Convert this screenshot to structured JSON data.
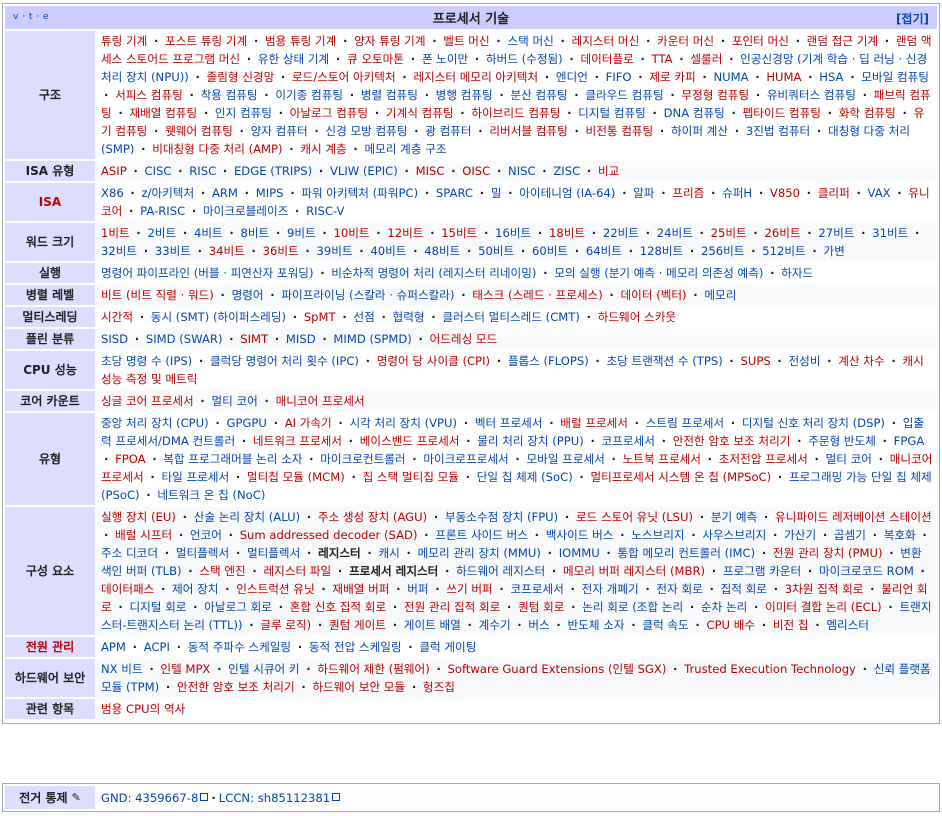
{
  "navbox": {
    "vte": [
      "v",
      "t",
      "e"
    ],
    "title": "프로세서 기술",
    "collapse_label": "[접기]"
  },
  "rows": [
    {
      "header": "구조",
      "header_red": false,
      "items": [
        [
          "튜링 기계",
          "new"
        ],
        [
          "포스트 튜링 기계",
          "new"
        ],
        [
          "범용 튜링 기계",
          "new"
        ],
        [
          "양자 튜링 기계",
          "new"
        ],
        [
          "벨트 머신",
          "new"
        ],
        [
          "스택 머신",
          "lnk"
        ],
        [
          "레지스터 머신",
          "new"
        ],
        [
          "카운터 머신",
          "new"
        ],
        [
          "포인터 머신",
          "new"
        ],
        [
          "랜덤 접근 기계",
          "new"
        ],
        [
          "랜덤 액세스 스토어드 프로그램 머신",
          "new"
        ],
        [
          "유한 상태 기계",
          "lnk"
        ],
        [
          "큐 오토마톤",
          "new"
        ],
        [
          "폰 노이만",
          "lnk"
        ],
        [
          "하버드 (수정됨)",
          "lnk"
        ],
        [
          "데이터플로",
          "new"
        ],
        [
          "TTA",
          "new"
        ],
        [
          "셀룰러",
          "new"
        ],
        [
          "인공신경망 (기계 학습 · 딥 러닝 · 신경 처리 장치 (NPU))",
          "lnk"
        ],
        [
          "졸림형 신경망",
          "new"
        ],
        [
          "로드/스토어 아키텍처",
          "new"
        ],
        [
          "레지스터 메모리 아키텍처",
          "new"
        ],
        [
          "엔디언",
          "lnk"
        ],
        [
          "FIFO",
          "lnk"
        ],
        [
          "제로 카피",
          "new"
        ],
        [
          "NUMA",
          "lnk"
        ],
        [
          "HUMA",
          "new"
        ],
        [
          "HSA",
          "lnk"
        ],
        [
          "모바일 컴퓨팅",
          "lnk"
        ],
        [
          "서피스 컴퓨팅",
          "new"
        ],
        [
          "착용 컴퓨팅",
          "lnk"
        ],
        [
          "이기종 컴퓨팅",
          "lnk"
        ],
        [
          "병렬 컴퓨팅",
          "lnk"
        ],
        [
          "병행 컴퓨팅",
          "lnk"
        ],
        [
          "분산 컴퓨팅",
          "lnk"
        ],
        [
          "클라우드 컴퓨팅",
          "lnk"
        ],
        [
          "무정형 컴퓨팅",
          "new"
        ],
        [
          "유비쿼터스 컴퓨팅",
          "lnk"
        ],
        [
          "패브릭 컴퓨팅",
          "new"
        ],
        [
          "재배열 컴퓨팅",
          "new"
        ],
        [
          "인지 컴퓨팅",
          "lnk"
        ],
        [
          "아날로그 컴퓨팅",
          "new"
        ],
        [
          "기계식 컴퓨팅",
          "new"
        ],
        [
          "하이브리드 컴퓨팅",
          "new"
        ],
        [
          "디지털 컴퓨팅",
          "lnk"
        ],
        [
          "DNA 컴퓨팅",
          "lnk"
        ],
        [
          "펩타이드 컴퓨팅",
          "new"
        ],
        [
          "화학 컴퓨팅",
          "new"
        ],
        [
          "유기 컴퓨팅",
          "new"
        ],
        [
          "웻웨어 컴퓨팅",
          "new"
        ],
        [
          "양자 컴퓨터",
          "lnk"
        ],
        [
          "신경 모방 컴퓨팅",
          "lnk"
        ],
        [
          "광 컴퓨터",
          "lnk"
        ],
        [
          "리버서블 컴퓨팅",
          "new"
        ],
        [
          "비전통 컴퓨팅",
          "new"
        ],
        [
          "하이퍼 계산",
          "lnk"
        ],
        [
          "3진법 컴퓨터",
          "lnk"
        ],
        [
          "대칭형 다중 처리 (SMP)",
          "lnk"
        ],
        [
          "비대칭형 다중 처리 (AMP)",
          "new"
        ],
        [
          "캐시 계층",
          "new"
        ],
        [
          "메모리 계층 구조",
          "lnk"
        ]
      ]
    },
    {
      "header": "ISA 유형",
      "header_red": false,
      "items": [
        [
          "ASIP",
          "new"
        ],
        [
          "CISC",
          "lnk"
        ],
        [
          "RISC",
          "lnk"
        ],
        [
          "EDGE (TRIPS)",
          "lnk"
        ],
        [
          "VLIW (EPIC)",
          "lnk"
        ],
        [
          "MISC",
          "new"
        ],
        [
          "OISC",
          "new"
        ],
        [
          "NISC",
          "lnk"
        ],
        [
          "ZISC",
          "lnk"
        ],
        [
          "비교",
          "new"
        ]
      ]
    },
    {
      "header": "ISA",
      "header_red": true,
      "items": [
        [
          "X86",
          "lnk"
        ],
        [
          "z/아키텍처",
          "lnk"
        ],
        [
          "ARM",
          "lnk"
        ],
        [
          "MIPS",
          "lnk"
        ],
        [
          "파워 아키텍처 (파워PC)",
          "lnk"
        ],
        [
          "SPARC",
          "lnk"
        ],
        [
          "밀",
          "lnk"
        ],
        [
          "아이테니엄 (IA-64)",
          "lnk"
        ],
        [
          "알파",
          "lnk"
        ],
        [
          "프리즘",
          "new"
        ],
        [
          "슈퍼H",
          "lnk"
        ],
        [
          "V850",
          "new"
        ],
        [
          "클리퍼",
          "new"
        ],
        [
          "VAX",
          "lnk"
        ],
        [
          "유니코어",
          "new"
        ],
        [
          "PA-RISC",
          "lnk"
        ],
        [
          "마이크로블레이즈",
          "lnk"
        ],
        [
          "RISC-V",
          "lnk"
        ]
      ]
    },
    {
      "header": "워드 크기",
      "header_red": false,
      "items": [
        [
          "1비트",
          "new"
        ],
        [
          "2비트",
          "lnk"
        ],
        [
          "4비트",
          "lnk"
        ],
        [
          "8비트",
          "lnk"
        ],
        [
          "9비트",
          "lnk"
        ],
        [
          "10비트",
          "new"
        ],
        [
          "12비트",
          "new"
        ],
        [
          "15비트",
          "new"
        ],
        [
          "16비트",
          "lnk"
        ],
        [
          "18비트",
          "new"
        ],
        [
          "22비트",
          "lnk"
        ],
        [
          "24비트",
          "lnk"
        ],
        [
          "25비트",
          "new"
        ],
        [
          "26비트",
          "new"
        ],
        [
          "27비트",
          "lnk"
        ],
        [
          "31비트",
          "lnk"
        ],
        [
          "32비트",
          "lnk"
        ],
        [
          "33비트",
          "lnk"
        ],
        [
          "34비트",
          "new"
        ],
        [
          "36비트",
          "new"
        ],
        [
          "39비트",
          "lnk"
        ],
        [
          "40비트",
          "lnk"
        ],
        [
          "48비트",
          "lnk"
        ],
        [
          "50비트",
          "lnk"
        ],
        [
          "60비트",
          "lnk"
        ],
        [
          "64비트",
          "lnk"
        ],
        [
          "128비트",
          "lnk"
        ],
        [
          "256비트",
          "lnk"
        ],
        [
          "512비트",
          "lnk"
        ],
        [
          "가변",
          "lnk"
        ]
      ]
    },
    {
      "header": "실행",
      "header_red": false,
      "items": [
        [
          "명령어 파이프라인 (버블 · 피연산자 포워딩)",
          "lnk"
        ],
        [
          "비순차적 명령어 처리 (레지스터 리네이밍)",
          "lnk"
        ],
        [
          "모의 실행 (분기 예측 · 메모리 의존성 예측)",
          "lnk"
        ],
        [
          "하자드",
          "lnk"
        ]
      ]
    },
    {
      "header": "병렬 레벨",
      "header_red": false,
      "items": [
        [
          "비트 (비트 직렬 · 워드)",
          "new"
        ],
        [
          "명령어",
          "lnk"
        ],
        [
          "파이프라이닝 (스칼라 · 슈퍼스칼라)",
          "lnk"
        ],
        [
          "태스크 (스레드 · 프로세스)",
          "new"
        ],
        [
          "데이터 (벡터)",
          "new"
        ],
        [
          "메모리",
          "lnk"
        ]
      ]
    },
    {
      "header": "멀티스레딩",
      "header_red": false,
      "items": [
        [
          "시간적",
          "new"
        ],
        [
          "동시 (SMT) (하이퍼스레딩)",
          "lnk"
        ],
        [
          "SpMT",
          "new"
        ],
        [
          "선점",
          "lnk"
        ],
        [
          "협력형",
          "lnk"
        ],
        [
          "클러스터 멀티스레드 (CMT)",
          "lnk"
        ],
        [
          "하드웨어 스카웃",
          "new"
        ]
      ]
    },
    {
      "header": "플린 분류",
      "header_red": false,
      "items": [
        [
          "SISD",
          "lnk"
        ],
        [
          "SIMD (SWAR)",
          "lnk"
        ],
        [
          "SIMT",
          "new"
        ],
        [
          "MISD",
          "lnk"
        ],
        [
          "MIMD (SPMD)",
          "lnk"
        ],
        [
          "어드레싱 모드",
          "new"
        ]
      ]
    },
    {
      "header": "CPU 성능",
      "header_red": false,
      "items": [
        [
          "초당 명령 수 (IPS)",
          "lnk"
        ],
        [
          "클럭당 명령어 처리 횟수 (IPC)",
          "lnk"
        ],
        [
          "명령어 당 사이클 (CPI)",
          "new"
        ],
        [
          "플롭스 (FLOPS)",
          "lnk"
        ],
        [
          "초당 트랜잭션 수 (TPS)",
          "lnk"
        ],
        [
          "SUPS",
          "new"
        ],
        [
          "전성비",
          "lnk"
        ],
        [
          "계산 차수",
          "new"
        ],
        [
          "캐시 성능 측정 및 메트릭",
          "new"
        ]
      ]
    },
    {
      "header": "코어 카운트",
      "header_red": false,
      "items": [
        [
          "싱글 코어 프로세서",
          "new"
        ],
        [
          "멀티 코어",
          "lnk"
        ],
        [
          "매니코어 프로세서",
          "new"
        ]
      ]
    },
    {
      "header": "유형",
      "header_red": false,
      "items": [
        [
          "중앙 처리 장치 (CPU)",
          "lnk"
        ],
        [
          "GPGPU",
          "lnk"
        ],
        [
          "AI 가속기",
          "new"
        ],
        [
          "시각 처리 장치 (VPU)",
          "lnk"
        ],
        [
          "벡터 프로세서",
          "lnk"
        ],
        [
          "배럴 프로세서",
          "new"
        ],
        [
          "스트림 프로세서",
          "lnk"
        ],
        [
          "디지털 신호 처리 장치 (DSP)",
          "lnk"
        ],
        [
          "입출력 프로세서/DMA 컨트롤러",
          "lnk"
        ],
        [
          "네트워크 프로세서",
          "new"
        ],
        [
          "베이스밴드 프로세서",
          "new"
        ],
        [
          "물리 처리 장치 (PPU)",
          "lnk"
        ],
        [
          "코프로세서",
          "lnk"
        ],
        [
          "안전한 암호 보조 처리기",
          "new"
        ],
        [
          "주문형 반도체",
          "lnk"
        ],
        [
          "FPGA",
          "lnk"
        ],
        [
          "FPOA",
          "new"
        ],
        [
          "복합 프로그래머블 논리 소자",
          "lnk"
        ],
        [
          "마이크로컨트롤러",
          "lnk"
        ],
        [
          "마이크로프로세서",
          "lnk"
        ],
        [
          "모바일 프로세서",
          "lnk"
        ],
        [
          "노트북 프로세서",
          "new"
        ],
        [
          "초저전압 프로세서",
          "new"
        ],
        [
          "멀티 코어",
          "lnk"
        ],
        [
          "매니코어 프로세서",
          "new"
        ],
        [
          "타일 프로세서",
          "lnk"
        ],
        [
          "멀티칩 모듈 (MCM)",
          "new"
        ],
        [
          "칩 스택 멀티칩 모듈",
          "new"
        ],
        [
          "단일 칩 체제 (SoC)",
          "lnk"
        ],
        [
          "멀티프로세서 시스템 온 칩 (MPSoC)",
          "new"
        ],
        [
          "프로그래밍 가능 단일 칩 체제 (PSoC)",
          "lnk"
        ],
        [
          "네트워크 온 칩 (NoC)",
          "lnk"
        ]
      ]
    },
    {
      "header": "구성 요소",
      "header_red": false,
      "items": [
        [
          "실행 장치 (EU)",
          "new"
        ],
        [
          "산술 논리 장치 (ALU)",
          "lnk"
        ],
        [
          "주소 생성 장치 (AGU)",
          "new"
        ],
        [
          "부동소수점 장치 (FPU)",
          "lnk"
        ],
        [
          "로드 스토어 유닛 (LSU)",
          "new"
        ],
        [
          "분기 예측",
          "lnk"
        ],
        [
          "유니파이드 레저베이션 스테이션",
          "new"
        ],
        [
          "배럴 시프터",
          "new"
        ],
        [
          "언코어",
          "lnk"
        ],
        [
          "Sum addressed decoder (SAD)",
          "new"
        ],
        [
          "프론트 사이드 버스",
          "lnk"
        ],
        [
          "백사이드 버스",
          "lnk"
        ],
        [
          "노스브리지",
          "lnk"
        ],
        [
          "사우스브리지",
          "lnk"
        ],
        [
          "가산기",
          "lnk"
        ],
        [
          "곱셈기",
          "lnk"
        ],
        [
          "복호화",
          "lnk"
        ],
        [
          "주소 디코더",
          "lnk"
        ],
        [
          "멀티플렉서",
          "lnk"
        ],
        [
          "멀티플렉서",
          "lnk"
        ],
        [
          "레지스터",
          "bold"
        ],
        [
          "캐시",
          "lnk"
        ],
        [
          "메모리 관리 장치 (MMU)",
          "lnk"
        ],
        [
          "IOMMU",
          "lnk"
        ],
        [
          "통합 메모리 컨트롤러 (IMC)",
          "lnk"
        ],
        [
          "전원 관리 장치 (PMU)",
          "new"
        ],
        [
          "변환 색인 버퍼 (TLB)",
          "lnk"
        ],
        [
          "스택 엔진",
          "new"
        ],
        [
          "레지스터 파일",
          "new"
        ],
        [
          "프로세서 레지스터",
          "bold"
        ],
        [
          "하드웨어 레지스터",
          "lnk"
        ],
        [
          "메모리 버퍼 레지스터 (MBR)",
          "new"
        ],
        [
          "프로그램 카운터",
          "lnk"
        ],
        [
          "마이크로코드 ROM",
          "lnk"
        ],
        [
          "데이터패스",
          "new"
        ],
        [
          "제어 장치",
          "lnk"
        ],
        [
          "인스트럭션 유닛",
          "new"
        ],
        [
          "재배열 버퍼",
          "new"
        ],
        [
          "버퍼",
          "lnk"
        ],
        [
          "쓰기 버퍼",
          "new"
        ],
        [
          "코프로세서",
          "lnk"
        ],
        [
          "전자 개폐기",
          "lnk"
        ],
        [
          "전자 회로",
          "lnk"
        ],
        [
          "집적 회로",
          "lnk"
        ],
        [
          "3차원 집적 회로",
          "new"
        ],
        [
          "불리언 회로",
          "new"
        ],
        [
          "디지털 회로",
          "lnk"
        ],
        [
          "아날로그 회로",
          "lnk"
        ],
        [
          "혼합 신호 집적 회로",
          "new"
        ],
        [
          "전원 관리 집적 회로",
          "new"
        ],
        [
          "퀀텀 회로",
          "new"
        ],
        [
          "논리 회로 (조합 논리",
          "lnk"
        ],
        [
          "순차 논리",
          "lnk"
        ],
        [
          "이미터 결합 논리 (ECL)",
          "new"
        ],
        [
          "트랜지스터-트랜지스터 논리 (TTL))",
          "lnk"
        ],
        [
          "글루 로직)",
          "new"
        ],
        [
          "퀀텀 게이트",
          "new"
        ],
        [
          "게이트 배열",
          "lnk"
        ],
        [
          "계수기",
          "lnk"
        ],
        [
          "버스",
          "lnk"
        ],
        [
          "반도체 소자",
          "lnk"
        ],
        [
          "클럭 속도",
          "lnk"
        ],
        [
          "CPU 배수",
          "new"
        ],
        [
          "비전 칩",
          "new"
        ],
        [
          "멤리스터",
          "lnk"
        ]
      ]
    },
    {
      "header": "전원 관리",
      "header_red": true,
      "items": [
        [
          "APM",
          "lnk"
        ],
        [
          "ACPI",
          "lnk"
        ],
        [
          "동적 주파수 스케일링",
          "lnk"
        ],
        [
          "동적 전압 스케일링",
          "lnk"
        ],
        [
          "클럭 게이팅",
          "lnk"
        ]
      ]
    },
    {
      "header": "하드웨어 보안",
      "header_red": false,
      "items": [
        [
          "NX 비트",
          "lnk"
        ],
        [
          "인텔 MPX",
          "new"
        ],
        [
          "인텔 시큐어 키",
          "lnk"
        ],
        [
          "하드웨어 제한 (펌웨어)",
          "new"
        ],
        [
          "Software Guard Extensions (인텔 SGX)",
          "new"
        ],
        [
          "Trusted Execution Technology",
          "new"
        ],
        [
          "신뢰 플랫폼 모듈 (TPM)",
          "lnk"
        ],
        [
          "안전한 암호 보조 처리기",
          "new"
        ],
        [
          "하드웨어 보안 모듈",
          "new"
        ],
        [
          "헝즈칩",
          "new"
        ]
      ]
    },
    {
      "header": "관련 항목",
      "header_red": false,
      "items": [
        [
          "범용 CPU의 역사",
          "new"
        ]
      ]
    }
  ],
  "authority": {
    "header": "전거 통제",
    "items": [
      "GND: 4359667-8",
      "LCCN: sh85112381"
    ]
  }
}
